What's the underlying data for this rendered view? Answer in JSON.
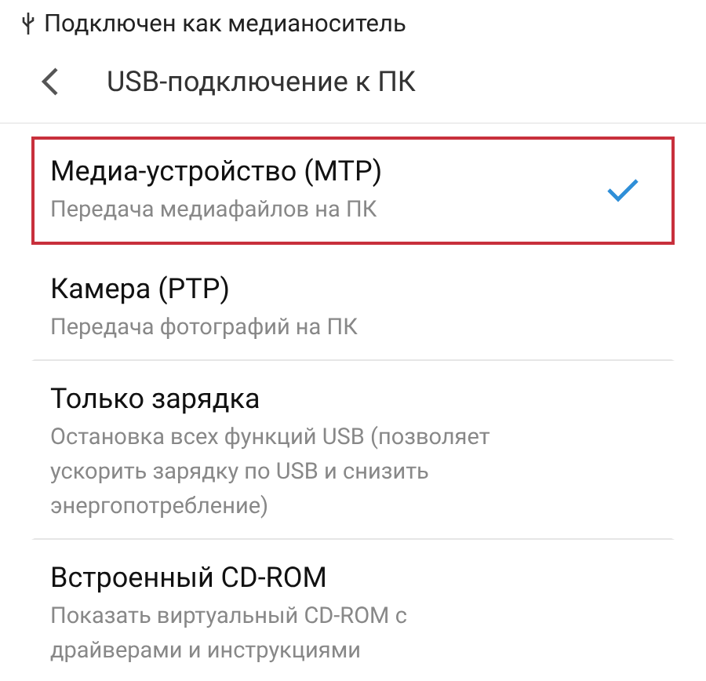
{
  "status_bar": {
    "text": "Подключен как медианоситель"
  },
  "header": {
    "title": "USB-подключение к ПК"
  },
  "options": [
    {
      "title": "Медиа-устройство (MTP)",
      "subtitle": "Передача медиафайлов на ПК",
      "selected": true,
      "highlighted": true
    },
    {
      "title": "Камера (PTP)",
      "subtitle": "Передача фотографий на ПК",
      "selected": false,
      "highlighted": false
    },
    {
      "title": "Только зарядка",
      "subtitle": "Остановка всех функций USB (позволяет ускорить зарядку по USB и снизить энергопотребление)",
      "selected": false,
      "highlighted": false
    },
    {
      "title": "Встроенный CD-ROM",
      "subtitle": "Показать виртуальный CD-ROM с драйверами и инструкциями",
      "selected": false,
      "highlighted": false
    }
  ]
}
